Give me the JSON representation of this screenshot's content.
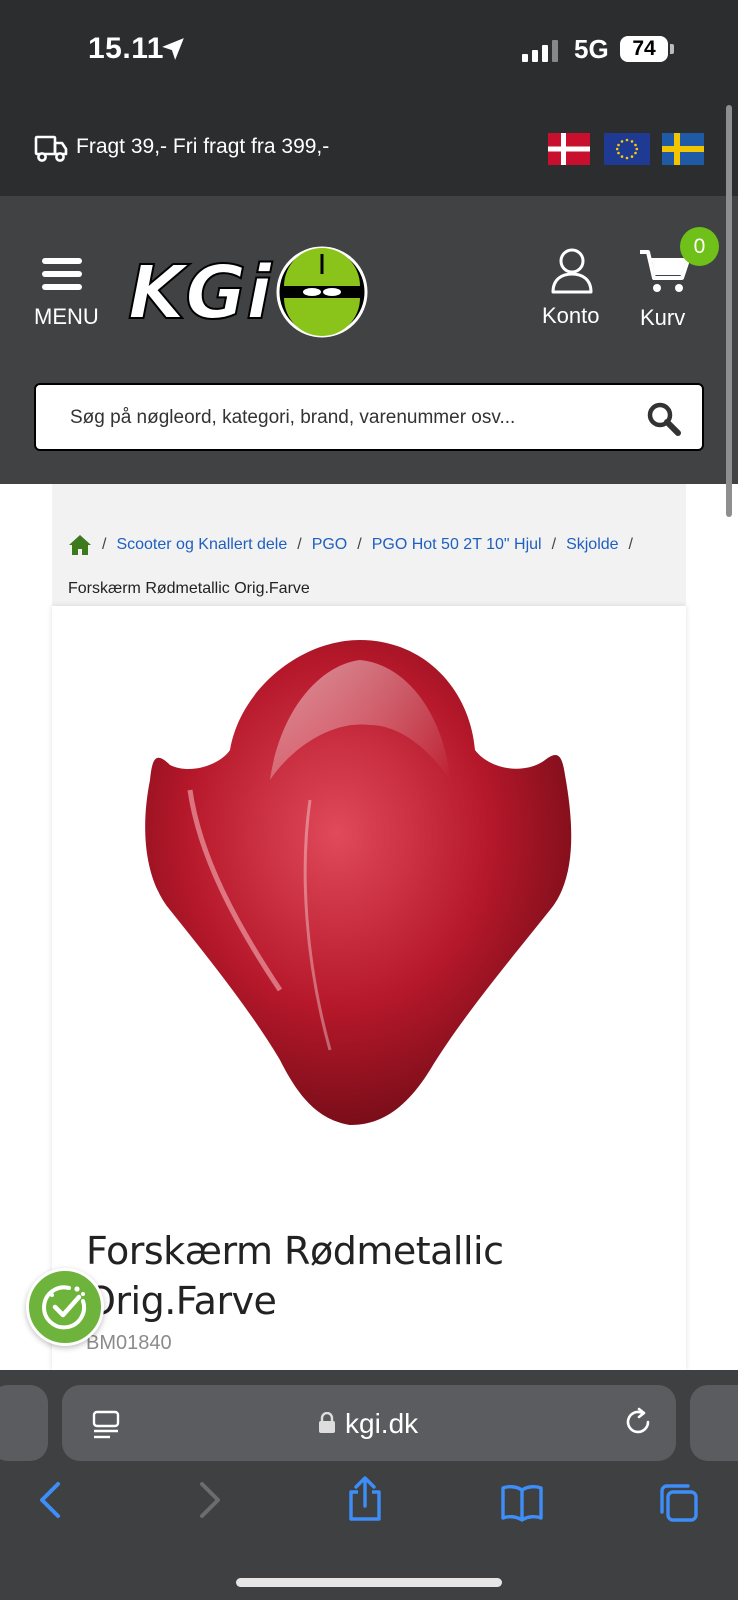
{
  "status_bar": {
    "time": "15.11",
    "network": "5G",
    "battery": "74"
  },
  "shipping": {
    "text": "Fragt 39,- Fri fragt fra 399,-"
  },
  "flags": [
    "denmark-flag",
    "eu-flag",
    "sweden-flag"
  ],
  "header": {
    "menu_label": "MENU",
    "logo_text": "KGi",
    "account_label": "Konto",
    "cart_label": "Kurv",
    "cart_count": "0"
  },
  "search": {
    "placeholder": "Søg på nøgleord, kategori, brand, varenummer osv..."
  },
  "breadcrumb": {
    "items": [
      "Scooter og Knallert dele",
      "PGO",
      "PGO Hot 50 2T 10\" Hjul",
      "Skjolde"
    ],
    "current": "Forskærm Rødmetallic Orig.Farve"
  },
  "product": {
    "title": "Forskærm Rødmetallic Orig.Farve",
    "sku": "BM01840"
  },
  "browser": {
    "url": "kgi.dk"
  },
  "colors": {
    "dark_bar": "#2c2d2f",
    "header_bg": "#414244",
    "accent_green": "#6fc11a",
    "link_blue": "#1f5fbf",
    "safari_blue": "#3d8ef8"
  }
}
